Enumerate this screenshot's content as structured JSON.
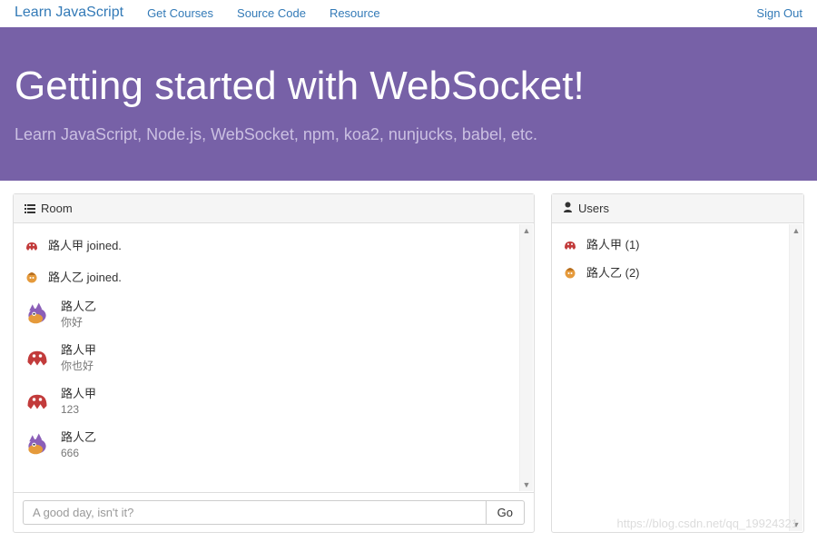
{
  "nav": {
    "brand": "Learn JavaScript",
    "links": [
      "Get Courses",
      "Source Code",
      "Resource"
    ],
    "signout": "Sign Out"
  },
  "hero": {
    "title": "Getting started with WebSocket!",
    "subtitle": "Learn JavaScript, Node.js, WebSocket, npm, koa2, nunjucks, babel, etc."
  },
  "room": {
    "heading": "Room",
    "messages": [
      {
        "type": "join",
        "avatar": "red",
        "text": "路人甲 joined."
      },
      {
        "type": "join",
        "avatar": "orange",
        "text": "路人乙 joined."
      },
      {
        "type": "msg",
        "avatar": "purple",
        "user": "路人乙",
        "text": "你好"
      },
      {
        "type": "msg",
        "avatar": "red",
        "user": "路人甲",
        "text": "你也好"
      },
      {
        "type": "msg",
        "avatar": "red",
        "user": "路人甲",
        "text": "123"
      },
      {
        "type": "msg",
        "avatar": "purple",
        "user": "路人乙",
        "text": "666"
      }
    ],
    "input_placeholder": "A good day, isn't it?",
    "go_label": "Go"
  },
  "users": {
    "heading": "Users",
    "list": [
      {
        "avatar": "red",
        "label": "路人甲 (1)"
      },
      {
        "avatar": "orange",
        "label": "路人乙 (2)"
      }
    ]
  },
  "watermark": "https://blog.csdn.net/qq_19924321",
  "avatar_colors": {
    "red": {
      "body": "#c23b3b",
      "accent": "#7b2020"
    },
    "orange": {
      "body": "#e59a3b",
      "accent": "#b86f1f"
    },
    "purple": {
      "body": "#8b5fb8",
      "accent": "#e59a3b"
    }
  }
}
